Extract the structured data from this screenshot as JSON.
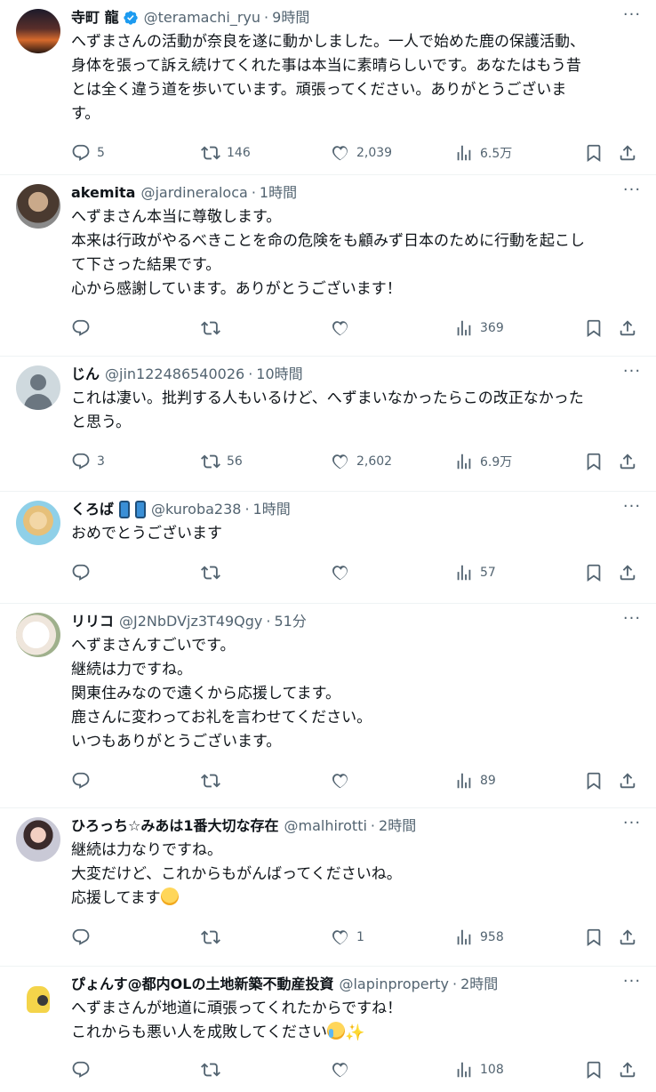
{
  "tweets": [
    {
      "avatar_icon": "sunset-avatar",
      "name": "寺町 龍",
      "verified": true,
      "handle": "@teramachi_ryu",
      "time": "9時間",
      "text": "へずまさんの活動が奈良を遂に動かしました。一人で始めた鹿の保護活動、\n身体を張って訴え続けてくれた事は本当に素晴らしいです。あなたはもう昔\nとは全く違う道を歩いています。頑張ってください。ありがとうございま\nす。",
      "replies": "5",
      "retweets": "146",
      "likes": "2,039",
      "views": "6.5万"
    },
    {
      "avatar_icon": "bearded-man-avatar",
      "name": "akemita",
      "handle": "@jardineraloca",
      "time": "1時間",
      "text": "へずまさん本当に尊敬します。\n本来は行政がやるべきことを命の危険をも顧みず日本のために行動を起こし\nて下さった結果です。\n心から感謝しています。ありがとうございます！",
      "replies": "",
      "retweets": "",
      "likes": "",
      "views": "369"
    },
    {
      "avatar_icon": "default-avatar",
      "name": "じん",
      "handle": "@jin122486540026",
      "time": "10時間",
      "text": "これは凄い。批判する人もいるけど、へずまいなかったらこの改正なかった\nと思う。",
      "replies": "3",
      "retweets": "56",
      "likes": "2,602",
      "views": "6.9万"
    },
    {
      "avatar_icon": "anime-character-avatar",
      "name": "くろば",
      "handle": "@kuroba238",
      "time": "1時間",
      "text": "おめでとうございます",
      "replies": "",
      "retweets": "",
      "likes": "",
      "views": "57"
    },
    {
      "avatar_icon": "dog-avatar",
      "name": "リリコ",
      "handle": "@J2NbDVjz3T49Qgy",
      "time": "51分",
      "text": "へずまさんすごいです。\n継続は力ですね。\n関東住みなので遠くから応援してます。\n鹿さんに変わってお礼を言わせてください。\nいつもありがとうございます。",
      "replies": "",
      "retweets": "",
      "likes": "",
      "views": "89"
    },
    {
      "avatar_icon": "idol-photo-avatar",
      "name": "ひろっち☆みあは1番大切な存在",
      "handle": "@malhirotti",
      "time": "2時間",
      "text": "継続は力なりですね。\n大変だけど、これからもがんばってくださいね。\n応援してます",
      "replies": "",
      "retweets": "",
      "likes": "1",
      "views": "958"
    },
    {
      "avatar_icon": "mimikyu-avatar",
      "name": "ぴょんす@都内OLの土地新築不動産投資",
      "handle": "@lapinproperty",
      "time": "2時間",
      "text": "へずまさんが地道に頑張ってくれたからですね！\nこれからも悪い人を成敗してください",
      "replies": "",
      "retweets": "",
      "likes": "",
      "views": "108"
    }
  ],
  "labels": {
    "dot": "·",
    "more": "···",
    "sparkles": "✨"
  },
  "colors": {
    "text": "#0f1419",
    "secondary": "#536471",
    "verified": "#1d9bf0",
    "divider": "#eff3f4"
  }
}
